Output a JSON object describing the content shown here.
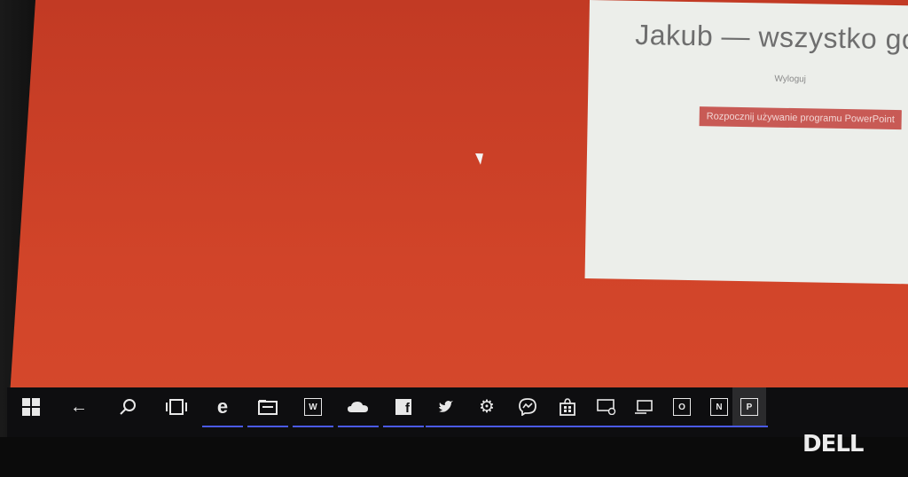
{
  "dialog": {
    "title": "Jakub — wszystko gotowe",
    "signout_label": "Wyloguj",
    "start_button_label": "Rozpocznij używanie programu PowerPoint"
  },
  "taskbar": {
    "items": [
      {
        "name": "start-button",
        "icon": "windows-logo-icon"
      },
      {
        "name": "back-button",
        "icon": "back-arrow-icon"
      },
      {
        "name": "search-button",
        "icon": "search-icon"
      },
      {
        "name": "task-view-button",
        "icon": "task-view-icon"
      },
      {
        "name": "edge-button",
        "icon": "edge-icon"
      },
      {
        "name": "file-explorer-button",
        "icon": "file-explorer-icon"
      },
      {
        "name": "word-button",
        "icon": "word-icon"
      },
      {
        "name": "onedrive-button",
        "icon": "onedrive-icon"
      },
      {
        "name": "facebook-button",
        "icon": "facebook-icon"
      },
      {
        "name": "twitter-button",
        "icon": "twitter-icon"
      },
      {
        "name": "settings-button",
        "icon": "gear-icon"
      },
      {
        "name": "messenger-button",
        "icon": "messenger-icon"
      },
      {
        "name": "store-button",
        "icon": "store-icon"
      },
      {
        "name": "remote-desktop-button",
        "icon": "remote-desktop-icon"
      },
      {
        "name": "connect-button",
        "icon": "connect-icon"
      },
      {
        "name": "outlook-button",
        "icon": "outlook-icon"
      },
      {
        "name": "onenote-button",
        "icon": "onenote-icon"
      },
      {
        "name": "powerpoint-button",
        "icon": "powerpoint-icon"
      }
    ],
    "underline_color": "#4a5ae8"
  },
  "colors": {
    "desktop_background": "#d14429",
    "taskbar": "#0e0e10",
    "start_button_bg": "#c85a55"
  },
  "monitor": {
    "brand": "DELL"
  }
}
